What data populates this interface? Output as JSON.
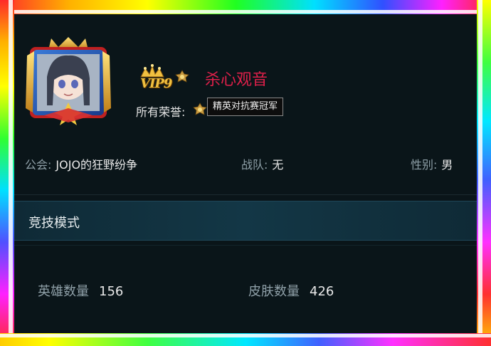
{
  "profile": {
    "vip_label": "VIP9",
    "name": "杀心观音",
    "honors_label": "所有荣誉:",
    "honor_tooltip": "精英对抗赛冠军"
  },
  "info": {
    "guild_key": "公会:",
    "guild_val": "JOJO的狂野纷争",
    "team_key": "战队:",
    "team_val": "无",
    "gender_key": "性别:",
    "gender_val": "男"
  },
  "section": {
    "title": "竞技模式"
  },
  "stats": {
    "heroes_key": "英雄数量",
    "heroes_val": "156",
    "skins_key": "皮肤数量",
    "skins_val": "426"
  },
  "colors": {
    "name": "#e0204a",
    "vip_gold": "#f0c040",
    "panel_bg": "#0a1519",
    "section_bg": "#133746"
  },
  "icons": [
    "rainbow-frame",
    "avatar-frame",
    "vip-crown-icon",
    "medal-icon",
    "honor-medal-icon"
  ]
}
